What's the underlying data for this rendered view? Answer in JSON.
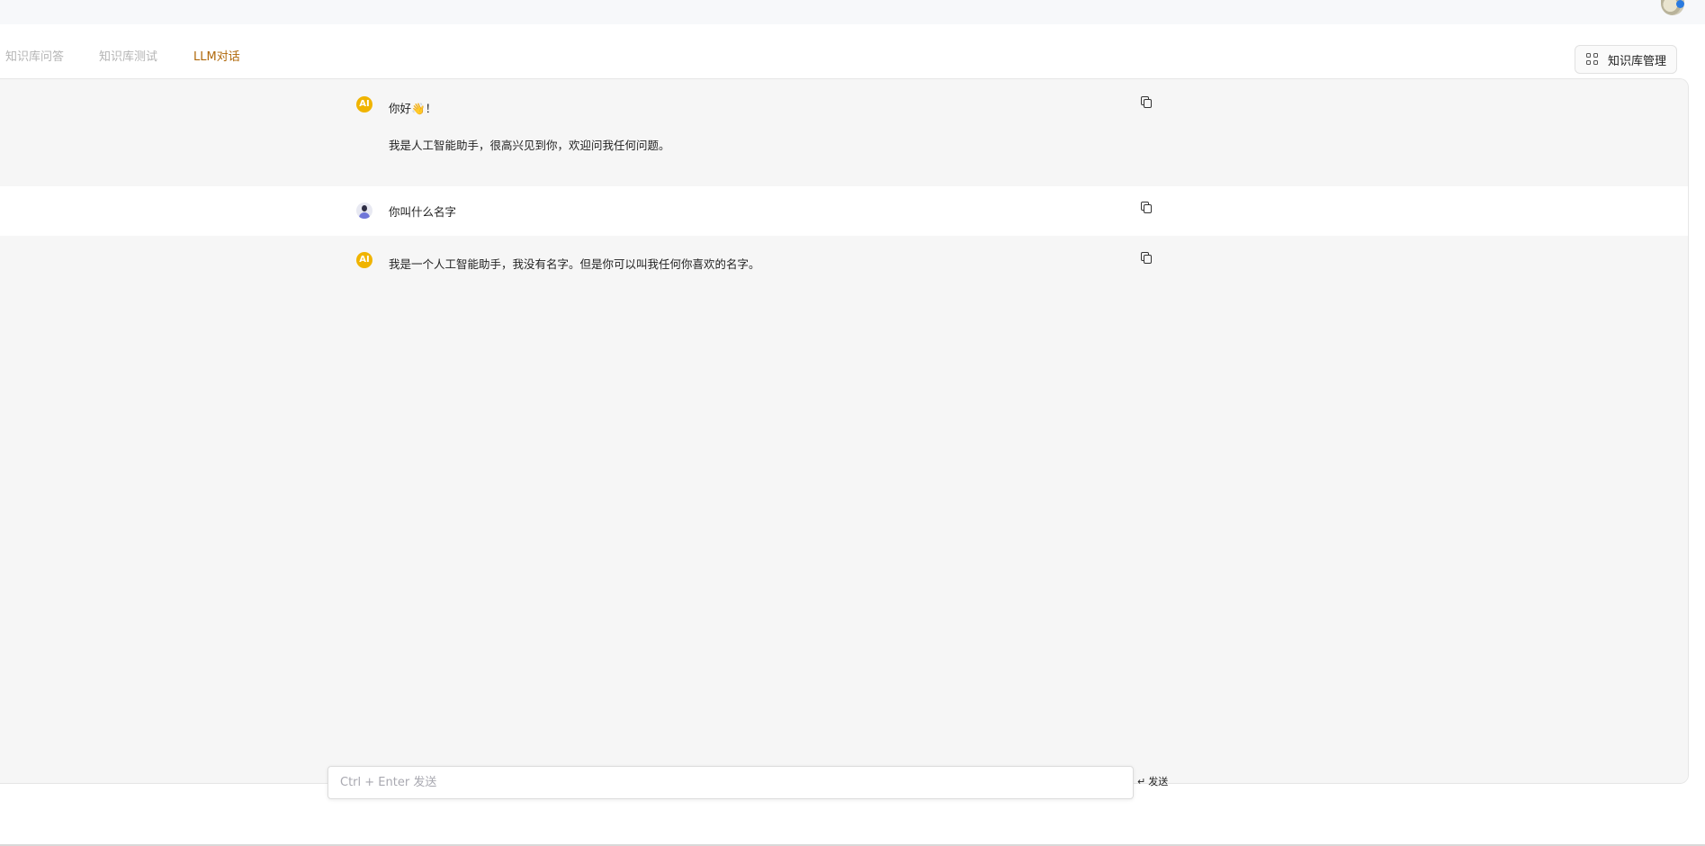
{
  "tabs": [
    {
      "label": "知识库问答",
      "active": false
    },
    {
      "label": "知识库测试",
      "active": false
    },
    {
      "label": "LLM对话",
      "active": true
    }
  ],
  "header": {
    "kb_manage_label": "知识库管理",
    "kb_manage_icon": "grid-icon",
    "user_avatar_icon": "avatar"
  },
  "messages": [
    {
      "role": "ai",
      "avatar_label": "AI",
      "line1": "你好👋！",
      "line2": "我是人工智能助手，很高兴见到你，欢迎问我任何问题。"
    },
    {
      "role": "user",
      "avatar_label": "",
      "line1": "你叫什么名字"
    },
    {
      "role": "ai",
      "avatar_label": "AI",
      "line1": "我是一个人工智能助手，我没有名字。但是你可以叫我任何你喜欢的名字。"
    }
  ],
  "composer": {
    "placeholder": "Ctrl + Enter 发送",
    "value": "",
    "send_icon": "↵",
    "send_label": "发送"
  },
  "colors": {
    "accent_tab": "#b0680a",
    "ai_avatar": "#f0b400",
    "panel_bg": "#f6f6f6"
  }
}
